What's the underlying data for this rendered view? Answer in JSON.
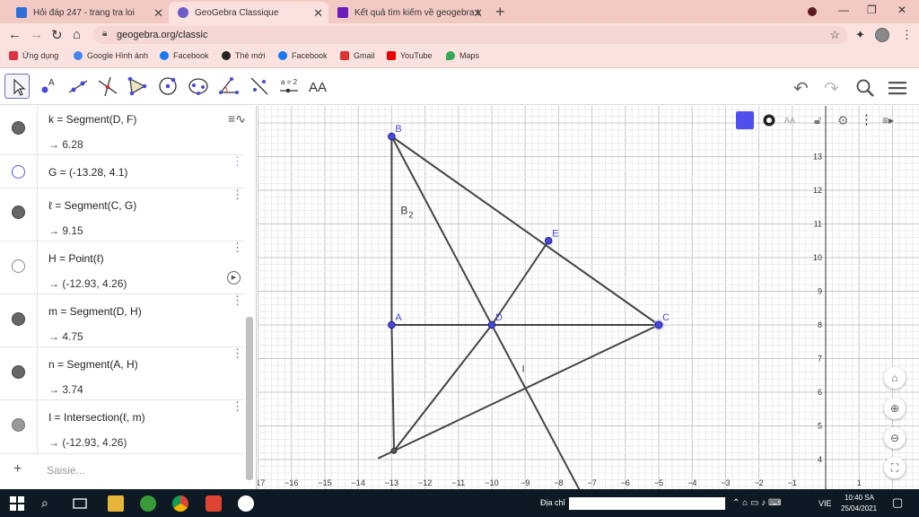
{
  "browser": {
    "tabs": [
      {
        "title": "Hỏi đáp 247 - trang tra loi",
        "color": "#2f6fdb"
      },
      {
        "title": "GeoGebra Classique",
        "color": "#6b5cc7"
      },
      {
        "title": "Kết quả tìm kiếm về geogebra trên",
        "color": "#6a1bbd"
      }
    ],
    "new_tab": "+",
    "url": "geogebra.org/classic",
    "bookmarks": [
      {
        "label": "Ứng dụng",
        "color": "#d34"
      },
      {
        "label": "Google Hình ảnh",
        "color": "#4285f4"
      },
      {
        "label": "Facebook",
        "color": "#1877f2"
      },
      {
        "label": "Thẻ mới",
        "color": "#222"
      },
      {
        "label": "Facebook",
        "color": "#1877f2"
      },
      {
        "label": "Gmail",
        "color": "#d33"
      },
      {
        "label": "YouTube",
        "color": "#e00"
      },
      {
        "label": "Maps",
        "color": "#34a853"
      }
    ]
  },
  "toolbar": {
    "right_icons": [
      "undo-icon",
      "redo-icon",
      "search-icon",
      "menu-icon"
    ],
    "text_tool": "AA",
    "slider_tool": "a = 2"
  },
  "algebra": {
    "rows": [
      {
        "def": "k = Segment(D, F)",
        "val": "→  6.28",
        "shown": true
      },
      {
        "def": "G = (-13.28, 4.1)",
        "val": "",
        "shown": false
      },
      {
        "def": "ℓ = Segment(C, G)",
        "val": "→  9.15",
        "shown": true
      },
      {
        "def": "H = Point(ℓ)",
        "val": "→  (-12.93, 4.26)",
        "shown": false
      },
      {
        "def": "m = Segment(D, H)",
        "val": "→  4.75",
        "shown": true
      },
      {
        "def": "n = Segment(A, H)",
        "val": "→  3.74",
        "shown": true
      },
      {
        "def": "I = Intersection(ℓ, m)",
        "val": "→  (-12.93, 4.26)",
        "shown": true
      }
    ],
    "input_placeholder": "Saisie..."
  },
  "graphics": {
    "x_ticks": [
      "−17",
      "−16",
      "−15",
      "−14",
      "−13",
      "−12",
      "−11",
      "−10",
      "−9",
      "−8",
      "−7",
      "−6",
      "−5",
      "−4",
      "−3",
      "−2",
      "−1",
      "1"
    ],
    "y_ticks": [
      "13",
      "12",
      "11",
      "10",
      "9",
      "8",
      "7",
      "6",
      "5",
      "4"
    ],
    "points": [
      {
        "name": "B",
        "x": -13.0,
        "y": 13.6
      },
      {
        "name": "A",
        "x": -13.0,
        "y": 8.0
      },
      {
        "name": "D",
        "x": -10.0,
        "y": 8.0
      },
      {
        "name": "C",
        "x": -5.0,
        "y": 8.0
      },
      {
        "name": "E",
        "x": -8.3,
        "y": 10.5
      },
      {
        "name": "H",
        "x": -12.93,
        "y": 4.26
      }
    ],
    "labels": {
      "b2": "B",
      "b2_sub": "2",
      "i": "I"
    }
  },
  "taskbar": {
    "search_label": "Địa chỉ",
    "lang": "VIE",
    "time": "10:40 SA",
    "date": "25/04/2021"
  }
}
